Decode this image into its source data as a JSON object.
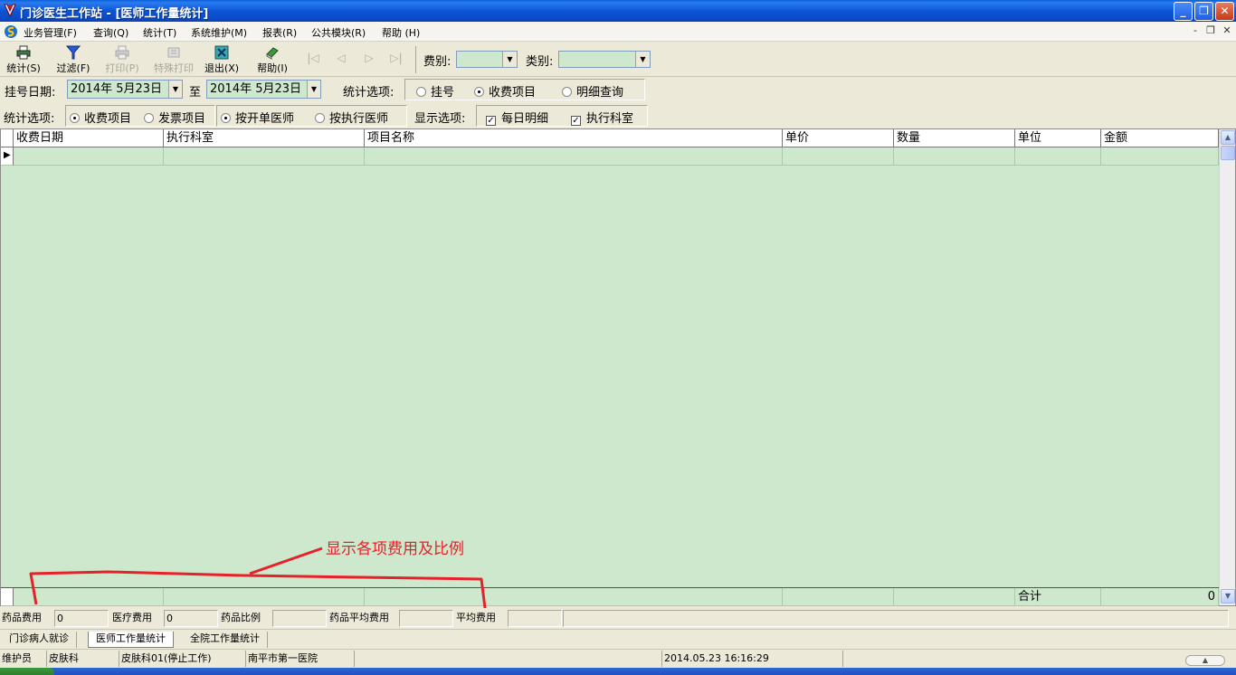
{
  "window": {
    "title": "门诊医生工作站 - [医师工作量统计]",
    "buttons": {
      "minimize": "_",
      "restore": "❐",
      "close": "✕"
    }
  },
  "menu": {
    "items": [
      "业务管理(F)",
      "查询(Q)",
      "统计(T)",
      "系统维护(M)",
      "报表(R)",
      "公共模块(R)",
      "帮助 (H)"
    ],
    "mdi_controls": [
      "-",
      "❐",
      "✕"
    ]
  },
  "toolbar": {
    "buttons": [
      {
        "label": "统计(S)",
        "icon": "printer-icon",
        "enabled": true
      },
      {
        "label": "过滤(F)",
        "icon": "filter-icon",
        "enabled": true
      },
      {
        "label": "打印(P)",
        "icon": "printer-icon",
        "enabled": false
      },
      {
        "label": "特殊打印",
        "icon": "special-print-icon",
        "enabled": false
      },
      {
        "label": "退出(X)",
        "icon": "exit-icon",
        "enabled": true
      },
      {
        "label": "帮助(I)",
        "icon": "book-icon",
        "enabled": true
      }
    ],
    "nav": [
      "|◁",
      "◁",
      "▷",
      "▷|"
    ],
    "fee_label": "费别:",
    "fee_value": "",
    "category_label": "类别:",
    "category_value": ""
  },
  "filter_row1": {
    "date_label": "挂号日期:",
    "date_from": "2014年  5月23日",
    "to_label": "至",
    "date_to": "2014年  5月23日",
    "stat_label": "统计选项:",
    "options": [
      {
        "label": "挂号",
        "selected": false
      },
      {
        "label": "收费项目",
        "selected": true
      },
      {
        "label": "明细查询",
        "selected": false
      }
    ]
  },
  "filter_row2": {
    "stat_label": "统计选项:",
    "type_options": [
      {
        "label": "收费项目",
        "selected": true
      },
      {
        "label": "发票项目",
        "selected": false
      }
    ],
    "doctor_options": [
      {
        "label": "按开单医师",
        "selected": true
      },
      {
        "label": "按执行医师",
        "selected": false
      }
    ],
    "display_label": "显示选项:",
    "display_checks": [
      {
        "label": "每日明细",
        "checked": true
      },
      {
        "label": "执行科室",
        "checked": true
      }
    ]
  },
  "grid": {
    "columns": [
      "收费日期",
      "执行科室",
      "项目名称",
      "单价",
      "数量",
      "单位",
      "金额"
    ],
    "rows": [],
    "footer_label": "合计",
    "footer_value": "0"
  },
  "summary": {
    "drug_fee_label": "药品费用",
    "drug_fee_value": "0",
    "medical_fee_label": "医疗费用",
    "medical_fee_value": "0",
    "drug_ratio_label": "药品比例",
    "drug_ratio_value": "",
    "drug_avg_label": "药品平均费用",
    "drug_avg_value": "",
    "avg_fee_label": "平均费用",
    "avg_fee_value": ""
  },
  "tabs": [
    {
      "label": "门诊病人就诊",
      "active": false
    },
    {
      "label": "医师工作量统计",
      "active": true
    },
    {
      "label": "全院工作量统计",
      "active": false
    }
  ],
  "status": {
    "user": "维护员",
    "department": "皮肤科",
    "room": "皮肤科01(停止工作)",
    "hospital": "南平市第一医院",
    "datetime": "2014.05.23 16:16:29"
  },
  "annotation": {
    "text": "显示各项费用及比例",
    "color": "#e8202a"
  }
}
